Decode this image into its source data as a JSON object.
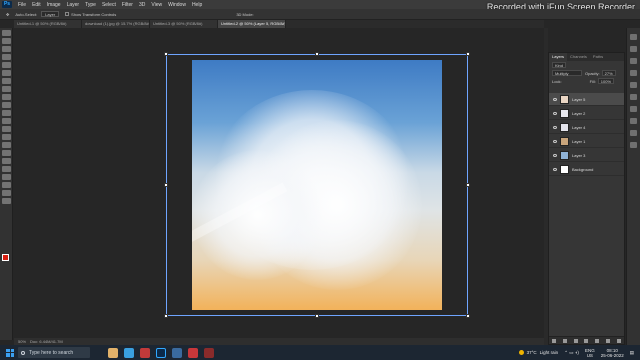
{
  "menubar": {
    "logo": "Ps",
    "items": [
      "File",
      "Edit",
      "Image",
      "Layer",
      "Type",
      "Select",
      "Filter",
      "3D",
      "View",
      "Window",
      "Help"
    ]
  },
  "options": {
    "auto_select_label": "Auto-Select:",
    "auto_select_value": "Layer",
    "show_transform_label": "Show Transform Controls",
    "mode_3d": "3D Mode:"
  },
  "tabs": [
    {
      "label": "Untitled-1 @ 50% (RGB/8#)"
    },
    {
      "label": "download (1).jpg @ 15.7% (RGB/8#)"
    },
    {
      "label": "Untitled-3 @ 50% (RGB/8#)"
    },
    {
      "label": "Untitled-2 @ 50% (Layer 5, RGB/8#)",
      "active": true
    }
  ],
  "watermark": "Recorded with iFun Screen Recorder",
  "status": {
    "zoom": "50%",
    "doc_size": "Doc: 6.44M/41.7M"
  },
  "layers_panel": {
    "tabs": [
      "Layers",
      "Channels",
      "Paths"
    ],
    "kind_label": "Kind",
    "blend_mode": "Multiply",
    "opacity_label": "Opacity:",
    "opacity_value": "27%",
    "lock_label": "Lock:",
    "fill_label": "Fill:",
    "fill_value": "100%",
    "layers": [
      {
        "name": "Layer 5",
        "selected": true,
        "thumb": "#e9d5c3"
      },
      {
        "name": "Layer 2",
        "selected": false,
        "thumb": "#e8e8ee"
      },
      {
        "name": "Layer 4",
        "selected": false,
        "thumb": "#e4e4ec"
      },
      {
        "name": "Layer 1",
        "selected": false,
        "thumb": "#c9a57c"
      },
      {
        "name": "Layer 3",
        "selected": false,
        "thumb": "#8fb2d6"
      },
      {
        "name": "Background",
        "selected": false,
        "thumb": "#ffffff"
      }
    ]
  },
  "taskbar": {
    "search_placeholder": "Type here to search",
    "weather_temp": "37°C",
    "weather_desc": "Light rain",
    "language": "ENG",
    "region": "US",
    "time": "08:10",
    "date": "25-06-2022"
  },
  "colors": {
    "accent": "#31a8ff",
    "foreground_color": "#d91f11",
    "background_color": "#ffffff"
  }
}
